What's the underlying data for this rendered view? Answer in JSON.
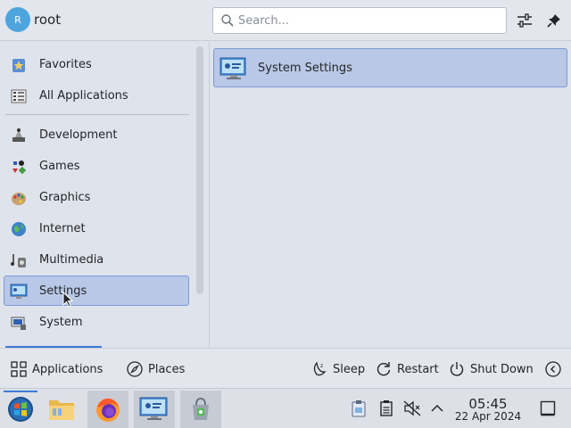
{
  "header": {
    "avatar_initial": "R",
    "username": "root",
    "search_placeholder": "Search..."
  },
  "categories": [
    {
      "label": "Favorites",
      "icon": "favorites-icon"
    },
    {
      "label": "All Applications",
      "icon": "all-applications-icon"
    },
    {
      "label": "Development",
      "icon": "development-icon"
    },
    {
      "label": "Games",
      "icon": "games-icon"
    },
    {
      "label": "Graphics",
      "icon": "graphics-icon"
    },
    {
      "label": "Internet",
      "icon": "internet-icon"
    },
    {
      "label": "Multimedia",
      "icon": "multimedia-icon"
    },
    {
      "label": "Settings",
      "icon": "settings-icon",
      "selected": true
    },
    {
      "label": "System",
      "icon": "system-icon"
    }
  ],
  "results": [
    {
      "label": "System Settings",
      "icon": "system-settings-icon"
    }
  ],
  "footer": {
    "applications": "Applications",
    "places": "Places",
    "sleep": "Sleep",
    "restart": "Restart",
    "shutdown": "Shut Down"
  },
  "taskbar": {
    "apps": [
      "start-menu-icon",
      "file-manager-icon",
      "firefox-icon",
      "system-settings-icon",
      "discover-icon"
    ],
    "clock_time": "05:45",
    "clock_date": "22 Apr 2024"
  },
  "colors": {
    "accent": "#3d7bd6",
    "selection": "#b9c8e6",
    "selection_border": "#7d9bd3"
  }
}
